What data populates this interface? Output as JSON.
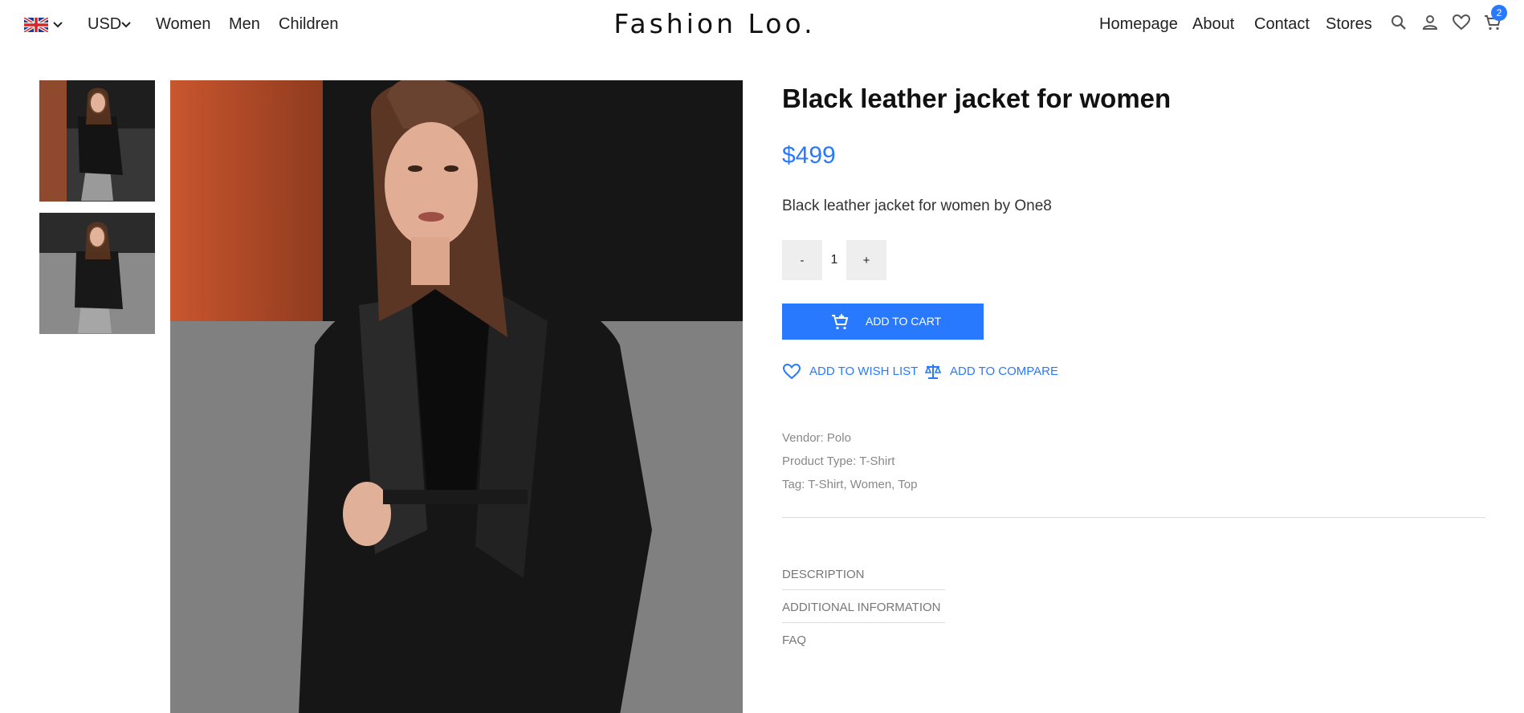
{
  "header": {
    "currency": "USD",
    "nav_left": [
      "Women",
      "Men",
      "Children"
    ],
    "logo": "Fashion Loo.",
    "nav_right": [
      "Homepage",
      "About",
      "Contact",
      "Stores"
    ],
    "cart_count": "2",
    "icons": [
      "uk-flag-icon",
      "chevron-down-icon",
      "search-icon",
      "user-icon",
      "heart-icon",
      "cart-icon"
    ]
  },
  "product": {
    "title": "Black leather jacket for women",
    "price": "$499",
    "description": "Black leather jacket for women by One8",
    "quantity": "1",
    "qty_minus": "-",
    "qty_plus": "+",
    "add_to_cart": "ADD TO CART",
    "add_to_wishlist": "ADD TO WISH LIST",
    "add_to_compare": "ADD TO COMPARE",
    "meta": {
      "vendor_label": "Vendor:",
      "vendor": "Polo",
      "type_label": "Product Type:",
      "type": "T-Shirt",
      "tag_label": "Tag:",
      "tags": "T-Shirt, Women, Top"
    },
    "tabs": [
      "DESCRIPTION",
      "ADDITIONAL INFORMATION",
      "FAQ"
    ]
  },
  "colors": {
    "accent": "#2979ff",
    "text": "#222222",
    "muted": "#888888",
    "button_bg": "#eeeeee"
  }
}
